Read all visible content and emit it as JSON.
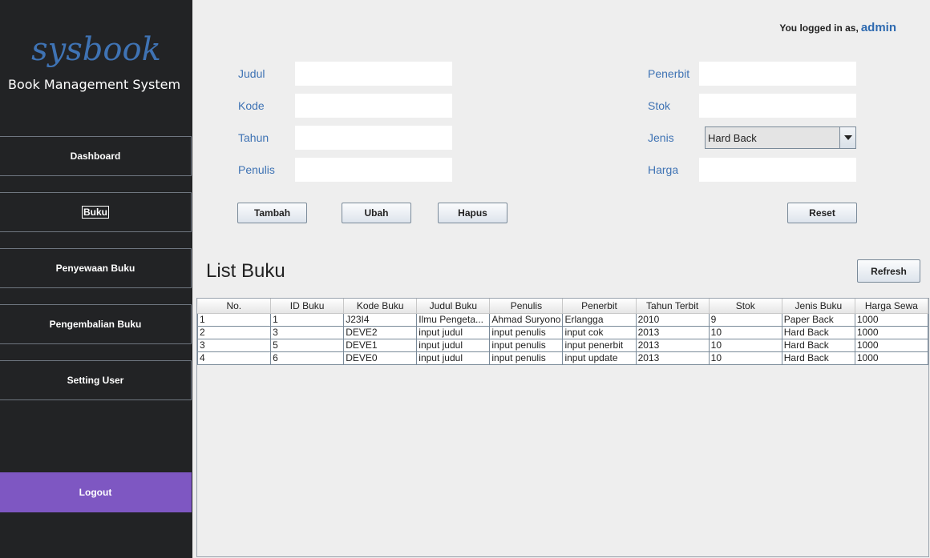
{
  "app": {
    "logo": "sysbook",
    "subtitle": "Book Management System"
  },
  "sidebar": {
    "items": [
      {
        "label": "Dashboard"
      },
      {
        "label": "Buku"
      },
      {
        "label": "Penyewaan Buku"
      },
      {
        "label": "Pengembalian Buku"
      },
      {
        "label": "Setting User"
      }
    ],
    "logout": "Logout"
  },
  "header": {
    "logged_in_text": "You logged in as,",
    "username": "admin"
  },
  "form": {
    "judul_label": "Judul",
    "kode_label": "Kode",
    "tahun_label": "Tahun",
    "penulis_label": "Penulis",
    "penerbit_label": "Penerbit",
    "stok_label": "Stok",
    "jenis_label": "Jenis",
    "harga_label": "Harga",
    "judul_value": "",
    "kode_value": "",
    "tahun_value": "",
    "penulis_value": "",
    "penerbit_value": "",
    "stok_value": "",
    "harga_value": "",
    "jenis_selected": "Hard Back"
  },
  "buttons": {
    "tambah": "Tambah",
    "ubah": "Ubah",
    "hapus": "Hapus",
    "reset": "Reset",
    "refresh": "Refresh"
  },
  "list": {
    "title": "List Buku",
    "columns": [
      "No.",
      "ID Buku",
      "Kode Buku",
      "Judul Buku",
      "Penulis",
      "Penerbit",
      "Tahun Terbit",
      "Stok",
      "Jenis Buku",
      "Harga Sewa"
    ],
    "rows": [
      [
        "1",
        "1",
        "J23I4",
        "Ilmu Pengeta...",
        "Ahmad Suryono",
        "Erlangga",
        "2010",
        "9",
        "Paper Back",
        "1000"
      ],
      [
        "2",
        "3",
        "DEVE2",
        "input judul",
        "input penulis",
        "input cok",
        "2013",
        "10",
        "Hard Back",
        "1000"
      ],
      [
        "3",
        "5",
        "DEVE1",
        "input judul",
        "input penulis",
        "input penerbit",
        "2013",
        "10",
        "Hard Back",
        "1000"
      ],
      [
        "4",
        "6",
        "DEVE0",
        "input judul",
        "input penulis",
        "input update",
        "2013",
        "10",
        "Hard Back",
        "1000"
      ]
    ]
  },
  "colors": {
    "sidebar_bg": "#222325",
    "accent_blue": "#3f73b4",
    "logout_purple": "#7e57c2"
  }
}
